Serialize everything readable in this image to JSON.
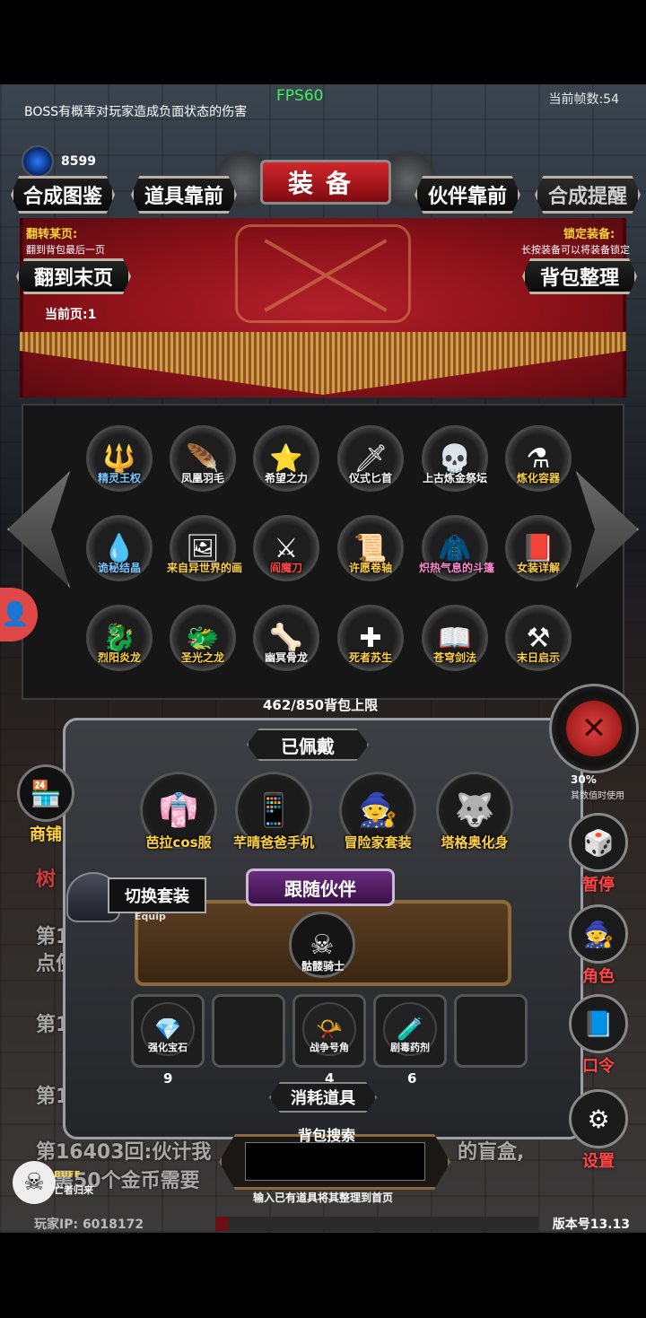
{
  "hud": {
    "fps": "FPS60",
    "frame_count": "当前帧数:54",
    "boss_tip": "BOSS有概率对玩家造成负面状态的伤害",
    "gem_count": "8599"
  },
  "top_nav": {
    "compose_gallery": "合成图鉴",
    "items_front": "道具靠前",
    "title": "装备",
    "partner_front": "伙伴靠前",
    "compose_remind": "合成提醒"
  },
  "controls": {
    "flip_label": "翻转某页:",
    "flip_desc": "翻到背包最后一页",
    "lock_label": "锁定装备:",
    "lock_desc": "长按装备可以将装备锁定",
    "to_last_page": "翻到末页",
    "sort_bag": "背包整理",
    "current_page": "当前页:1"
  },
  "grid_items": [
    {
      "name": "精灵王权",
      "icon": "🔱",
      "color": "#79c7ff"
    },
    {
      "name": "凤凰羽毛",
      "icon": "🪶",
      "color": "#ffffff"
    },
    {
      "name": "希望之力",
      "icon": "⭐",
      "color": "#ffffff"
    },
    {
      "name": "仪式匕首",
      "icon": "🗡",
      "color": "#ffffff"
    },
    {
      "name": "上古炼金祭坛",
      "icon": "💀",
      "color": "#ffffff"
    },
    {
      "name": "炼化容器",
      "icon": "⚗",
      "color": "#ffd23f"
    },
    {
      "name": "诡秘结晶",
      "icon": "💧",
      "color": "#79c7ff"
    },
    {
      "name": "来自异世界的画",
      "icon": "🖼",
      "color": "#ffd23f"
    },
    {
      "name": "阎魔刀",
      "icon": "⚔",
      "color": "#ff4545"
    },
    {
      "name": "许愿卷轴",
      "icon": "📜",
      "color": "#ffd23f"
    },
    {
      "name": "炽热气息的斗篷",
      "icon": "🧥",
      "color": "#ff8ad0"
    },
    {
      "name": "女装详解",
      "icon": "📕",
      "color": "#ffd23f"
    },
    {
      "name": "烈阳炎龙",
      "icon": "🐉",
      "color": "#ffd23f"
    },
    {
      "name": "圣光之龙",
      "icon": "🐲",
      "color": "#ffd23f"
    },
    {
      "name": "幽冥骨龙",
      "icon": "🦴",
      "color": "#ffffff"
    },
    {
      "name": "死者苏生",
      "icon": "✚",
      "color": "#ffd23f"
    },
    {
      "name": "苍穹剑法",
      "icon": "📖",
      "color": "#ffd23f"
    },
    {
      "name": "末日启示",
      "icon": "⚒",
      "color": "#ffd23f"
    }
  ],
  "bag_limit": "462/850背包上限",
  "equipped": {
    "title": "已佩戴",
    "items": [
      {
        "name": "芭拉cos服",
        "icon": "👘"
      },
      {
        "name": "芊晴爸爸手机",
        "icon": "📱"
      },
      {
        "name": "冒险家套装",
        "icon": "🧙"
      },
      {
        "name": "塔格奥化身",
        "icon": "🐺"
      }
    ]
  },
  "partner": {
    "title": "跟随伙伴",
    "name": "骷髅骑士",
    "icon": "☠"
  },
  "switch_set": {
    "label": "切换套装",
    "sub": "Equip"
  },
  "consumables": {
    "title": "消耗道具",
    "items": [
      {
        "name": "强化宝石",
        "icon": "💎",
        "count": "9"
      },
      {
        "name": "",
        "icon": "",
        "count": ""
      },
      {
        "name": "战争号角",
        "icon": "📯",
        "count": "4"
      },
      {
        "name": "剧毒药剂",
        "icon": "🧪",
        "count": "6"
      },
      {
        "name": "",
        "icon": "",
        "count": ""
      }
    ]
  },
  "search": {
    "label": "背包搜索",
    "placeholder": "",
    "hint": "输入已有道具将其整理到首页"
  },
  "side_menu": {
    "shop": "商铺",
    "pause": "暂停",
    "role": "角色",
    "command": "口令",
    "settings": "设置",
    "percent_note": "30%",
    "percent_sub": "其数值时使用"
  },
  "log": {
    "line_tree": "树",
    "line1a": "第16",
    "line1b": "点傍",
    "line2": "第16",
    "line3": "第1",
    "line4": "第16403回:伙计我",
    "line4b": "的盲盒,",
    "line5": "需50个金币需要"
  },
  "buff": {
    "label": "BUFF",
    "desc": "亡者归来"
  },
  "footer": {
    "player_ip": "玩家IP: 6018172",
    "version": "版本号13.13"
  }
}
